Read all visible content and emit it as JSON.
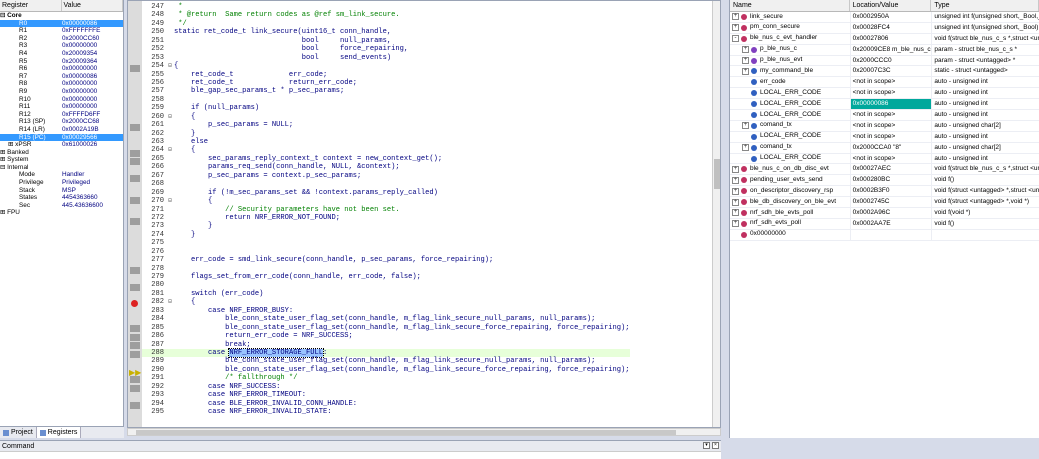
{
  "register_panel": {
    "col_register": "Register",
    "col_value": "Value",
    "rows": [
      {
        "name": "Core",
        "value": "",
        "indent": 0,
        "bold": true,
        "exp": "-"
      },
      {
        "name": "R0",
        "value": "0x00000086",
        "indent": 2,
        "sel": true
      },
      {
        "name": "R1",
        "value": "0xFFFFFFFE",
        "indent": 2
      },
      {
        "name": "R2",
        "value": "0x2000CC60",
        "indent": 2
      },
      {
        "name": "R3",
        "value": "0x00000000",
        "indent": 2
      },
      {
        "name": "R4",
        "value": "0x20009354",
        "indent": 2
      },
      {
        "name": "R5",
        "value": "0x20009364",
        "indent": 2
      },
      {
        "name": "R6",
        "value": "0x00000000",
        "indent": 2
      },
      {
        "name": "R7",
        "value": "0x00000086",
        "indent": 2
      },
      {
        "name": "R8",
        "value": "0x00000000",
        "indent": 2
      },
      {
        "name": "R9",
        "value": "0x00000000",
        "indent": 2
      },
      {
        "name": "R10",
        "value": "0x00000000",
        "indent": 2
      },
      {
        "name": "R11",
        "value": "0x00000000",
        "indent": 2
      },
      {
        "name": "R12",
        "value": "0xFFFFD6FF",
        "indent": 2
      },
      {
        "name": "R13 (SP)",
        "value": "0x2000CC68",
        "indent": 2
      },
      {
        "name": "R14 (LR)",
        "value": "0x0002A19B",
        "indent": 2
      },
      {
        "name": "R15 (PC)",
        "value": "0x00029566",
        "indent": 2,
        "sel": true
      },
      {
        "name": "xPSR",
        "value": "0x61000026",
        "indent": 1,
        "exp": "+"
      },
      {
        "name": "Banked",
        "value": "",
        "indent": 0,
        "exp": "+"
      },
      {
        "name": "System",
        "value": "",
        "indent": 0,
        "exp": "+"
      },
      {
        "name": "Internal",
        "value": "",
        "indent": 0,
        "exp": "-"
      },
      {
        "name": "Mode",
        "value": "Handler",
        "indent": 2
      },
      {
        "name": "Privilege",
        "value": "Privileged",
        "indent": 2
      },
      {
        "name": "Stack",
        "value": "MSP",
        "indent": 2
      },
      {
        "name": "States",
        "value": "4454363660",
        "indent": 2
      },
      {
        "name": "Sec",
        "value": "445.43636600",
        "indent": 2
      },
      {
        "name": "FPU",
        "value": "",
        "indent": 0,
        "exp": "+"
      }
    ],
    "tab_project": "Project",
    "tab_registers": "Registers"
  },
  "editor": {
    "lines": [
      {
        "n": "247",
        "t": " *",
        "c": true
      },
      {
        "n": "248",
        "t": " * @return  Same return codes as @ref sm_link_secure.",
        "c": true
      },
      {
        "n": "249",
        "t": " */",
        "c": true
      },
      {
        "n": "250",
        "t": "static ret_code_t link_secure(uint16_t conn_handle,"
      },
      {
        "n": "251",
        "t": "                              bool     null_params,"
      },
      {
        "n": "252",
        "t": "                              bool     force_repairing,"
      },
      {
        "n": "253",
        "t": "                              bool     send_events)"
      },
      {
        "n": "254",
        "t": "{",
        "f": "-"
      },
      {
        "n": "255",
        "t": "    ret_code_t             err_code;"
      },
      {
        "n": "256",
        "t": "    ret_code_t             return_err_code;"
      },
      {
        "n": "257",
        "t": "    ble_gap_sec_params_t * p_sec_params;"
      },
      {
        "n": "258",
        "t": ""
      },
      {
        "n": "259",
        "t": "    if (null_params)"
      },
      {
        "n": "260",
        "t": "    {",
        "f": "-"
      },
      {
        "n": "261",
        "t": "        p_sec_params = NULL;"
      },
      {
        "n": "262",
        "t": "    }"
      },
      {
        "n": "263",
        "t": "    else"
      },
      {
        "n": "264",
        "t": "    {",
        "f": "-"
      },
      {
        "n": "265",
        "t": "        sec_params_reply_context_t context = new_context_get();"
      },
      {
        "n": "266",
        "t": "        params_req_send(conn_handle, NULL, &context);"
      },
      {
        "n": "267",
        "t": "        p_sec_params = context.p_sec_params;"
      },
      {
        "n": "268",
        "t": ""
      },
      {
        "n": "269",
        "t": "        if (!m_sec_params_set && !context.params_reply_called)"
      },
      {
        "n": "270",
        "t": "        {",
        "f": "-"
      },
      {
        "n": "271",
        "t": "            // Security parameters have not been set.",
        "c": true
      },
      {
        "n": "272",
        "t": "            return NRF_ERROR_NOT_FOUND;"
      },
      {
        "n": "273",
        "t": "        }"
      },
      {
        "n": "274",
        "t": "    }"
      },
      {
        "n": "275",
        "t": ""
      },
      {
        "n": "276",
        "t": ""
      },
      {
        "n": "277",
        "t": "    err_code = smd_link_secure(conn_handle, p_sec_params, force_repairing);"
      },
      {
        "n": "278",
        "t": ""
      },
      {
        "n": "279",
        "t": "    flags_set_from_err_code(conn_handle, err_code, false);"
      },
      {
        "n": "280",
        "t": ""
      },
      {
        "n": "281",
        "t": "    switch (err_code)"
      },
      {
        "n": "282",
        "t": "    {",
        "f": "-"
      },
      {
        "n": "283",
        "t": "        case NRF_ERROR_BUSY:"
      },
      {
        "n": "284",
        "t": "            ble_conn_state_user_flag_set(conn_handle, m_flag_link_secure_null_params, null_params);"
      },
      {
        "n": "285",
        "t": "            ble_conn_state_user_flag_set(conn_handle, m_flag_link_secure_force_repairing, force_repairing);"
      },
      {
        "n": "286",
        "t": "            return_err_code = NRF_SUCCESS;"
      },
      {
        "n": "287",
        "t": "            break;"
      },
      {
        "n": "288",
        "t": "        case ",
        "sel": "NRF_ERROR_STORAGE_FULL",
        "rest": ":",
        "hl": true
      },
      {
        "n": "289",
        "t": "            ble_conn_state_user_flag_set(conn_handle, m_flag_link_secure_null_params, null_params);"
      },
      {
        "n": "290",
        "t": "            ble_conn_state_user_flag_set(conn_handle, m_flag_link_secure_force_repairing, force_repairing);"
      },
      {
        "n": "291",
        "t": "            /* fallthrough */",
        "c": true
      },
      {
        "n": "292",
        "t": "        case NRF_SUCCESS:"
      },
      {
        "n": "293",
        "t": "        case NRF_ERROR_TIMEOUT:"
      },
      {
        "n": "294",
        "t": "        case BLE_ERROR_INVALID_CONN_HANDLE:"
      },
      {
        "n": "295",
        "t": "        case NRF_ERROR_INVALID_STATE:"
      }
    ]
  },
  "watch": {
    "col_name": "Name",
    "col_value": "Location/Value",
    "col_type": "Type",
    "rows": [
      {
        "name": "link_secure",
        "value": "0x0002950A",
        "type": "unsigned int f(unsigned short,_Bool,_",
        "e": "+",
        "ic": "#c03060",
        "ind": 0
      },
      {
        "name": "pm_conn_secure",
        "value": "0x00028FC4",
        "type": "unsigned int f(unsigned short,_Bool)",
        "e": "+",
        "ic": "#c03060",
        "ind": 0
      },
      {
        "name": "ble_nus_c_evt_handler",
        "value": "0x00027806",
        "type": "void f(struct ble_nus_c_s *,struct <un",
        "e": "-",
        "ic": "#c03060",
        "ind": 0
      },
      {
        "name": "p_ble_nus_c",
        "value": "0x20009CE8 m_ble_nus_c",
        "type": "param - struct ble_nus_c_s *",
        "e": "+",
        "ic": "#8040c0",
        "ind": 1
      },
      {
        "name": "p_ble_nus_evt",
        "value": "0x2000CCC0",
        "type": "param - struct <untagged> *",
        "e": "+",
        "ic": "#8040c0",
        "ind": 1
      },
      {
        "name": "my_command_ble",
        "value": "0x20007C3C",
        "type": "static - struct <untagged>",
        "e": "+",
        "ic": "#3060c0",
        "ind": 1
      },
      {
        "name": "err_code",
        "value": "<not in scope>",
        "type": "auto - unsigned int",
        "e": "",
        "ic": "#3060c0",
        "ind": 1
      },
      {
        "name": "LOCAL_ERR_CODE",
        "value": "<not in scope>",
        "type": "auto - unsigned int",
        "e": "",
        "ic": "#3060c0",
        "ind": 1
      },
      {
        "name": "LOCAL_ERR_CODE",
        "value": "0x00000086",
        "type": "auto - unsigned int",
        "e": "",
        "ic": "#3060c0",
        "ind": 1,
        "hl": true
      },
      {
        "name": "LOCAL_ERR_CODE",
        "value": "<not in scope>",
        "type": "auto - unsigned int",
        "e": "",
        "ic": "#3060c0",
        "ind": 1
      },
      {
        "name": "comand_tx",
        "value": "<not in scope>",
        "type": "auto - unsigned char[2]",
        "e": "+",
        "ic": "#3060c0",
        "ind": 1
      },
      {
        "name": "LOCAL_ERR_CODE",
        "value": "<not in scope>",
        "type": "auto - unsigned int",
        "e": "",
        "ic": "#3060c0",
        "ind": 1
      },
      {
        "name": "comand_tx",
        "value": "0x2000CCA0 \"8\"",
        "type": "auto - unsigned char[2]",
        "e": "+",
        "ic": "#3060c0",
        "ind": 1
      },
      {
        "name": "LOCAL_ERR_CODE",
        "value": "<not in scope>",
        "type": "auto - unsigned int",
        "e": "",
        "ic": "#3060c0",
        "ind": 1
      },
      {
        "name": "ble_nus_c_on_db_disc_evt",
        "value": "0x00027AEC",
        "type": "void f(struct ble_nus_c_s *,struct <un",
        "e": "+",
        "ic": "#c03060",
        "ind": 0
      },
      {
        "name": "pending_user_evts_send",
        "value": "0x000280BC",
        "type": "void f()",
        "e": "+",
        "ic": "#c03060",
        "ind": 0
      },
      {
        "name": "on_descriptor_discovery_rsp",
        "value": "0x0002B3F0",
        "type": "void f(struct <untagged> *,struct <un",
        "e": "+",
        "ic": "#c03060",
        "ind": 0
      },
      {
        "name": "ble_db_discovery_on_ble_evt",
        "value": "0x0002745C",
        "type": "void f(struct <untagged> *,void *)",
        "e": "+",
        "ic": "#c03060",
        "ind": 0
      },
      {
        "name": "nrf_sdh_ble_evts_poll",
        "value": "0x0002A96C",
        "type": "void f(void *)",
        "e": "+",
        "ic": "#c03060",
        "ind": 0
      },
      {
        "name": "nrf_sdh_evts_poll",
        "value": "0x0002AA7E",
        "type": "void f()",
        "e": "+",
        "ic": "#c03060",
        "ind": 0
      },
      {
        "name": "0x00000000",
        "value": "",
        "type": "",
        "e": "",
        "ic": "#c03060",
        "ind": 0
      }
    ]
  },
  "command_bar": {
    "title": "Command"
  }
}
